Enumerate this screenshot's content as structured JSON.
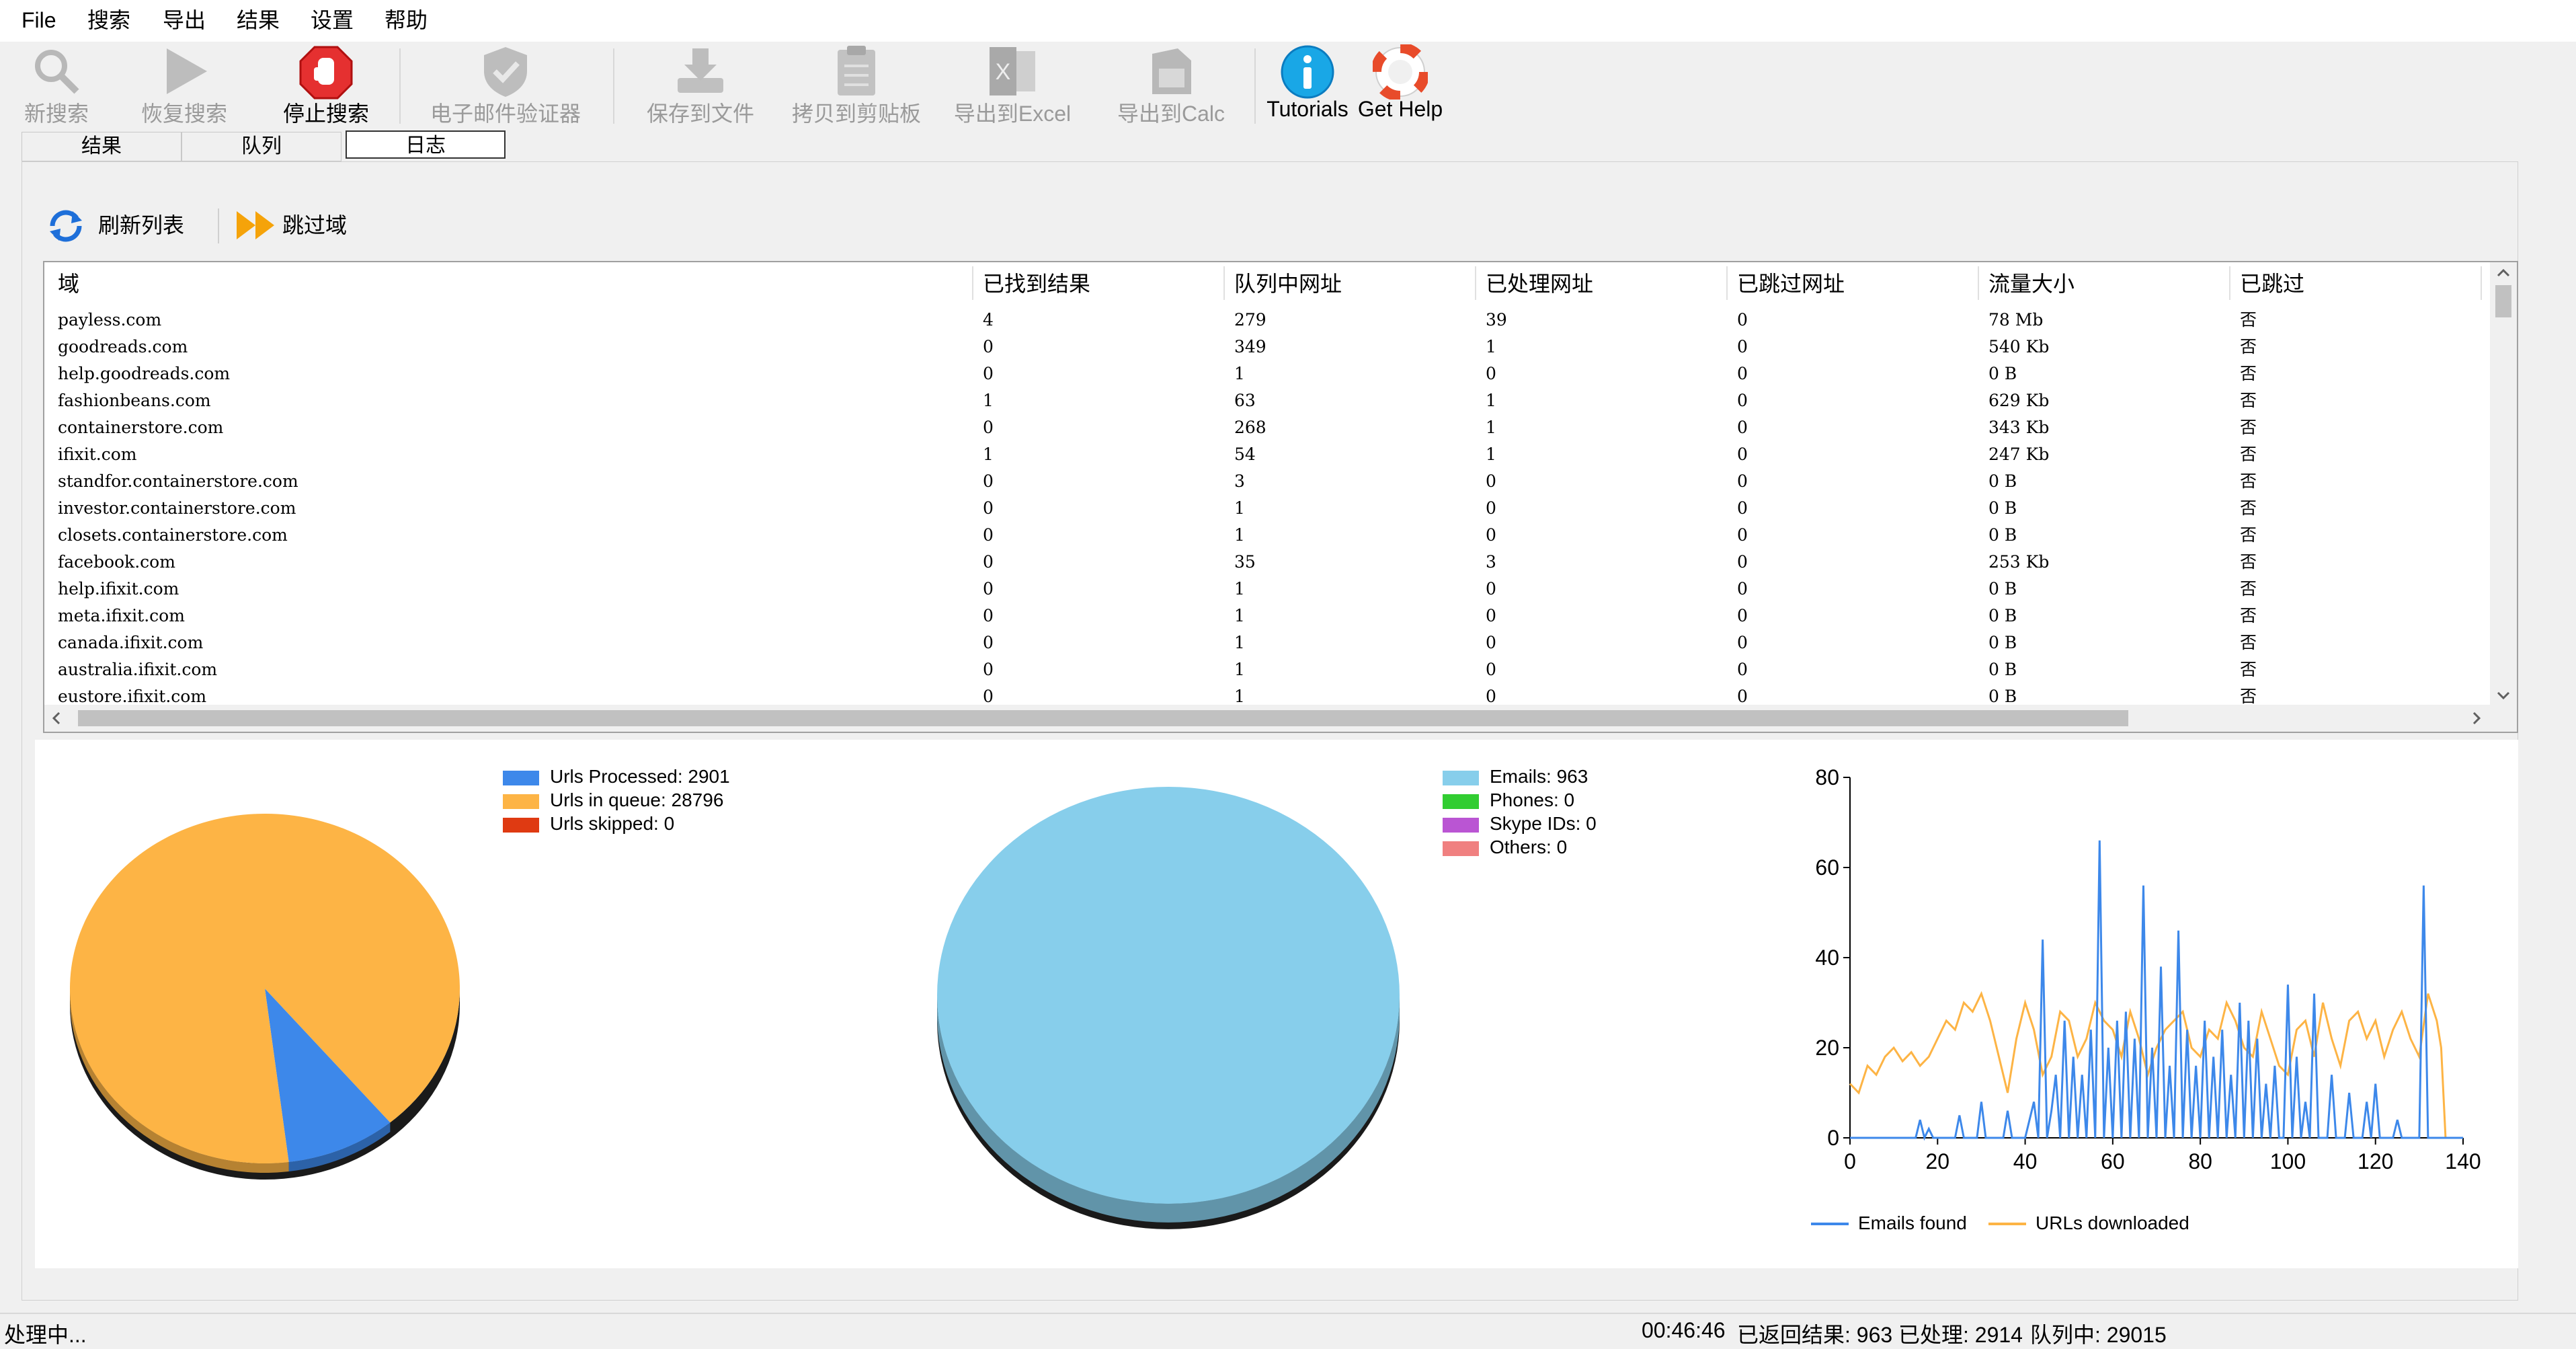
{
  "menu": [
    "File",
    "搜索",
    "导出",
    "结果",
    "设置",
    "帮助"
  ],
  "toolbar": {
    "new_search": "新搜索",
    "resume_search": "恢复搜索",
    "stop_search": "停止搜索",
    "email_validator": "电子邮件验证器",
    "save_to_file": "保存到文件",
    "copy_clipboard": "拷贝到剪贴板",
    "export_excel": "导出到Excel",
    "export_calc": "导出到Calc",
    "tutorials": "Tutorials",
    "get_help": "Get Help"
  },
  "tabs": [
    "结果",
    "队列",
    "日志"
  ],
  "subtoolbar": {
    "refresh": "刷新列表",
    "skip_domain": "跳过域"
  },
  "table": {
    "columns": [
      "域",
      "已找到结果",
      "队列中网址",
      "已处理网址",
      "已跳过网址",
      "流量大小",
      "已跳过"
    ],
    "rows": [
      [
        "payless.com",
        "4",
        "279",
        "39",
        "0",
        "78 Mb",
        "否"
      ],
      [
        "goodreads.com",
        "0",
        "349",
        "1",
        "0",
        "540 Kb",
        "否"
      ],
      [
        "help.goodreads.com",
        "0",
        "1",
        "0",
        "0",
        "0 B",
        "否"
      ],
      [
        "fashionbeans.com",
        "1",
        "63",
        "1",
        "0",
        "629 Kb",
        "否"
      ],
      [
        "containerstore.com",
        "0",
        "268",
        "1",
        "0",
        "343 Kb",
        "否"
      ],
      [
        "ifixit.com",
        "1",
        "54",
        "1",
        "0",
        "247 Kb",
        "否"
      ],
      [
        "standfor.containerstore.com",
        "0",
        "3",
        "0",
        "0",
        "0 B",
        "否"
      ],
      [
        "investor.containerstore.com",
        "0",
        "1",
        "0",
        "0",
        "0 B",
        "否"
      ],
      [
        "closets.containerstore.com",
        "0",
        "1",
        "0",
        "0",
        "0 B",
        "否"
      ],
      [
        "facebook.com",
        "0",
        "35",
        "3",
        "0",
        "253 Kb",
        "否"
      ],
      [
        "help.ifixit.com",
        "0",
        "1",
        "0",
        "0",
        "0 B",
        "否"
      ],
      [
        "meta.ifixit.com",
        "0",
        "1",
        "0",
        "0",
        "0 B",
        "否"
      ],
      [
        "canada.ifixit.com",
        "0",
        "1",
        "0",
        "0",
        "0 B",
        "否"
      ],
      [
        "australia.ifixit.com",
        "0",
        "1",
        "0",
        "0",
        "0 B",
        "否"
      ],
      [
        "eustore.ifixit.com",
        "0",
        "1",
        "0",
        "0",
        "0 B",
        "否"
      ]
    ]
  },
  "chart_data": [
    {
      "type": "pie",
      "labels": [
        "Urls Processed: 2901",
        "Urls in queue: 28796",
        "Urls skipped: 0"
      ],
      "values": [
        2901,
        28796,
        0
      ],
      "colors": [
        "#3d88ea",
        "#fdb445",
        "#df3a12"
      ]
    },
    {
      "type": "pie",
      "labels": [
        "Emails: 963",
        "Phones: 0",
        "Skype IDs: 0",
        "Others: 0"
      ],
      "values": [
        963,
        0,
        0,
        0
      ],
      "colors": [
        "#87ceeb",
        "#32cd32",
        "#ba55d3",
        "#f08080"
      ]
    },
    {
      "type": "line",
      "xlim": [
        0,
        140
      ],
      "ylim": [
        0,
        80
      ],
      "xticks": [
        0,
        20,
        40,
        60,
        80,
        100,
        120,
        140
      ],
      "yticks": [
        0,
        20,
        40,
        60,
        80
      ],
      "series": [
        {
          "name": "Emails found",
          "color": "#3d88ea",
          "x": [
            0,
            5,
            10,
            15,
            16,
            17,
            18,
            19,
            20,
            24,
            25,
            26,
            29,
            30,
            31,
            35,
            36,
            37,
            40,
            42,
            43,
            44,
            45,
            46,
            47,
            48,
            49,
            50,
            51,
            52,
            53,
            54,
            55,
            56,
            57,
            58,
            59,
            60,
            61,
            62,
            63,
            64,
            65,
            66,
            67,
            68,
            69,
            70,
            71,
            72,
            73,
            74,
            75,
            76,
            77,
            78,
            79,
            80,
            81,
            82,
            83,
            84,
            85,
            86,
            87,
            88,
            89,
            90,
            91,
            92,
            93,
            94,
            95,
            96,
            97,
            98,
            99,
            100,
            101,
            102,
            103,
            104,
            105,
            106,
            107,
            108,
            109,
            110,
            111,
            112,
            113,
            114,
            115,
            116,
            117,
            118,
            119,
            120,
            121,
            122,
            123,
            124,
            125,
            126,
            127,
            128,
            129,
            130,
            131,
            132,
            133,
            134,
            135,
            140
          ],
          "y": [
            0,
            0,
            0,
            0,
            4,
            0,
            2,
            0,
            0,
            0,
            5,
            0,
            0,
            8,
            0,
            0,
            6,
            0,
            0,
            8,
            0,
            44,
            0,
            6,
            14,
            0,
            26,
            0,
            18,
            0,
            14,
            0,
            24,
            0,
            66,
            0,
            20,
            0,
            26,
            0,
            28,
            0,
            22,
            0,
            56,
            0,
            20,
            0,
            38,
            0,
            16,
            0,
            46,
            0,
            24,
            0,
            16,
            0,
            26,
            0,
            18,
            0,
            24,
            0,
            14,
            0,
            30,
            0,
            26,
            0,
            22,
            0,
            12,
            0,
            16,
            0,
            0,
            34,
            0,
            18,
            0,
            8,
            0,
            32,
            0,
            0,
            0,
            14,
            0,
            0,
            0,
            10,
            0,
            0,
            0,
            8,
            0,
            12,
            0,
            0,
            0,
            0,
            4,
            0,
            0,
            0,
            0,
            0,
            56,
            0,
            0,
            0,
            0,
            0
          ]
        },
        {
          "name": "URLs downloaded",
          "color": "#fdb445",
          "x": [
            0,
            2,
            4,
            6,
            8,
            10,
            12,
            14,
            16,
            18,
            20,
            22,
            24,
            26,
            28,
            30,
            32,
            34,
            36,
            38,
            40,
            42,
            44,
            46,
            48,
            50,
            52,
            54,
            56,
            58,
            60,
            62,
            64,
            66,
            68,
            70,
            72,
            74,
            76,
            78,
            80,
            82,
            84,
            86,
            88,
            90,
            92,
            94,
            96,
            98,
            100,
            102,
            104,
            106,
            108,
            110,
            112,
            114,
            116,
            118,
            120,
            122,
            124,
            126,
            128,
            130,
            132,
            134,
            135,
            136
          ],
          "y": [
            12,
            10,
            16,
            14,
            18,
            20,
            17,
            19,
            16,
            18,
            22,
            26,
            24,
            30,
            28,
            32,
            26,
            18,
            10,
            22,
            30,
            24,
            14,
            18,
            28,
            26,
            18,
            22,
            30,
            26,
            24,
            18,
            28,
            22,
            14,
            20,
            24,
            26,
            28,
            20,
            18,
            24,
            22,
            30,
            26,
            20,
            18,
            28,
            22,
            16,
            14,
            24,
            26,
            18,
            30,
            22,
            16,
            26,
            28,
            22,
            26,
            18,
            24,
            28,
            22,
            18,
            32,
            26,
            20,
            0
          ]
        }
      ]
    }
  ],
  "legends": {
    "urls": [
      "Urls Processed: 2901",
      "Urls in queue: 28796",
      "Urls skipped: 0"
    ],
    "results": [
      "Emails: 963",
      "Phones: 0",
      "Skype IDs: 0",
      "Others: 0"
    ],
    "line": [
      "Emails found",
      "URLs downloaded"
    ]
  },
  "status": {
    "left": "处理中...",
    "time": "00:46:46",
    "returned": "已返回结果: 963",
    "processed": "已处理: 2914",
    "queue": "队列中: 29015"
  }
}
